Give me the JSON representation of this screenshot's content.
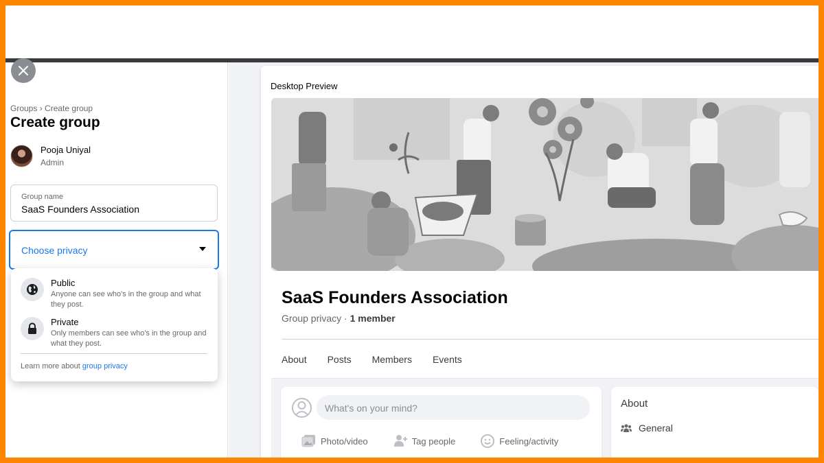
{
  "breadcrumb": {
    "root": "Groups",
    "separator": "›",
    "current": "Create group"
  },
  "page_title": "Create group",
  "admin": {
    "name": "Pooja Uniyal",
    "role": "Admin"
  },
  "group_name_field": {
    "label": "Group name",
    "value": "SaaS Founders Association"
  },
  "privacy_select": {
    "placeholder": "Choose privacy"
  },
  "privacy_options": [
    {
      "title": "Public",
      "desc": "Anyone can see who's in the group and what they post.",
      "icon": "globe-icon"
    },
    {
      "title": "Private",
      "desc": "Only members can see who's in the group and what they post.",
      "icon": "lock-icon"
    }
  ],
  "learn_more": {
    "text": "Learn more about ",
    "link": "group privacy"
  },
  "preview": {
    "title": "Desktop Preview",
    "group_title": "SaaS Founders Association",
    "privacy_text": "Group privacy · ",
    "member_count": "1 member",
    "tabs": [
      "About",
      "Posts",
      "Members",
      "Events"
    ],
    "composer_placeholder": "What's on your mind?",
    "composer_actions": [
      {
        "label": "Photo/video",
        "icon": "photo-icon"
      },
      {
        "label": "Tag people",
        "icon": "tag-people-icon"
      },
      {
        "label": "Feeling/activity",
        "icon": "feeling-icon"
      }
    ],
    "about_title": "About",
    "about_row": "General"
  },
  "colors": {
    "accent": "#1877f2",
    "frame": "#ff8500",
    "muted": "#65676b"
  }
}
